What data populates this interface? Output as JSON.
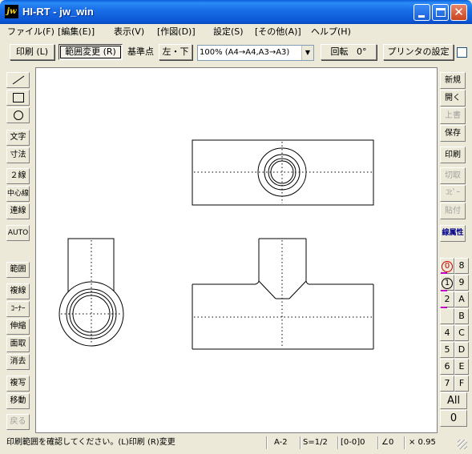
{
  "window": {
    "icon_text": "jw",
    "title": "HI-RT - jw_win",
    "controls": [
      "minimize",
      "maximize",
      "close"
    ]
  },
  "menu": [
    "ファイル(F)",
    "[編集(E)]",
    "表示(V)",
    "[作図(D)]",
    "設定(S)",
    "[その他(A)]",
    "ヘルプ(H)"
  ],
  "toolbar": {
    "print_label": "印刷 (L)",
    "range_change_label": "範囲変更 (R)",
    "base_point_label": "基準点",
    "base_point_value": "左・下",
    "scale_value": "100% (A4→A4,A3→A3)",
    "rotate_label": "回転",
    "rotate_value": "0°",
    "printer_settings_label": "プリンタの設定"
  },
  "left_tools": [
    {
      "name": "line-tool",
      "label": "",
      "icon": "line-icon",
      "enabled": true
    },
    {
      "name": "rect-tool",
      "label": "",
      "icon": "rectangle-icon",
      "enabled": true
    },
    {
      "name": "circle-tool",
      "label": "",
      "icon": "circle-icon",
      "enabled": true
    },
    {
      "name": "text-tool",
      "label": "文字",
      "enabled": true
    },
    {
      "name": "dimension-tool",
      "label": "寸法",
      "enabled": true
    },
    {
      "name": "double-line-tool",
      "label": "２線",
      "enabled": true
    },
    {
      "name": "centerline-tool",
      "label": "中心線",
      "enabled": true
    },
    {
      "name": "continuous-line-tool",
      "label": "連線",
      "enabled": true
    },
    {
      "name": "auto-tool",
      "label": "AUTO",
      "enabled": true
    },
    {
      "name": "range-tool",
      "label": "範囲",
      "enabled": true
    },
    {
      "name": "copy-line-tool",
      "label": "複線",
      "enabled": true
    },
    {
      "name": "corner-tool",
      "label": "ｺｰﾅｰ",
      "enabled": true
    },
    {
      "name": "stretch-tool",
      "label": "伸縮",
      "enabled": true
    },
    {
      "name": "chamfer-tool",
      "label": "面取",
      "enabled": true
    },
    {
      "name": "erase-tool",
      "label": "消去",
      "enabled": true
    },
    {
      "name": "duplicate-tool",
      "label": "複写",
      "enabled": true
    },
    {
      "name": "move-tool",
      "label": "移動",
      "enabled": true
    },
    {
      "name": "undo-tool",
      "label": "戻る",
      "enabled": false
    }
  ],
  "right_tools": [
    {
      "name": "new-button",
      "label": "新規",
      "enabled": true
    },
    {
      "name": "open-button",
      "label": "開く",
      "enabled": true
    },
    {
      "name": "overwrite-button",
      "label": "上書",
      "enabled": false
    },
    {
      "name": "save-button",
      "label": "保存",
      "enabled": true
    },
    {
      "name": "print-button",
      "label": "印刷",
      "enabled": true
    },
    {
      "name": "cut-button",
      "label": "切取",
      "enabled": false
    },
    {
      "name": "copy-button",
      "label": "ｺﾋﾟｰ",
      "enabled": false
    },
    {
      "name": "paste-button",
      "label": "貼付",
      "enabled": false
    },
    {
      "name": "line-attribute-button",
      "label": "線属性",
      "enabled": true
    }
  ],
  "layers": {
    "left": [
      "0",
      "1",
      "2",
      "",
      "4",
      "5",
      "6",
      "7"
    ],
    "right": [
      "8",
      "9",
      "A",
      "B",
      "C",
      "D",
      "E",
      "F"
    ],
    "all_label": "All",
    "zero_label": "0"
  },
  "status": {
    "message": "印刷範囲を確認してください。(L)印刷 (R)変更",
    "paper": "A-2",
    "scale": "S=1/2",
    "layer": "[0-0]0",
    "angle": "∠0",
    "zoom": "× 0.95"
  }
}
